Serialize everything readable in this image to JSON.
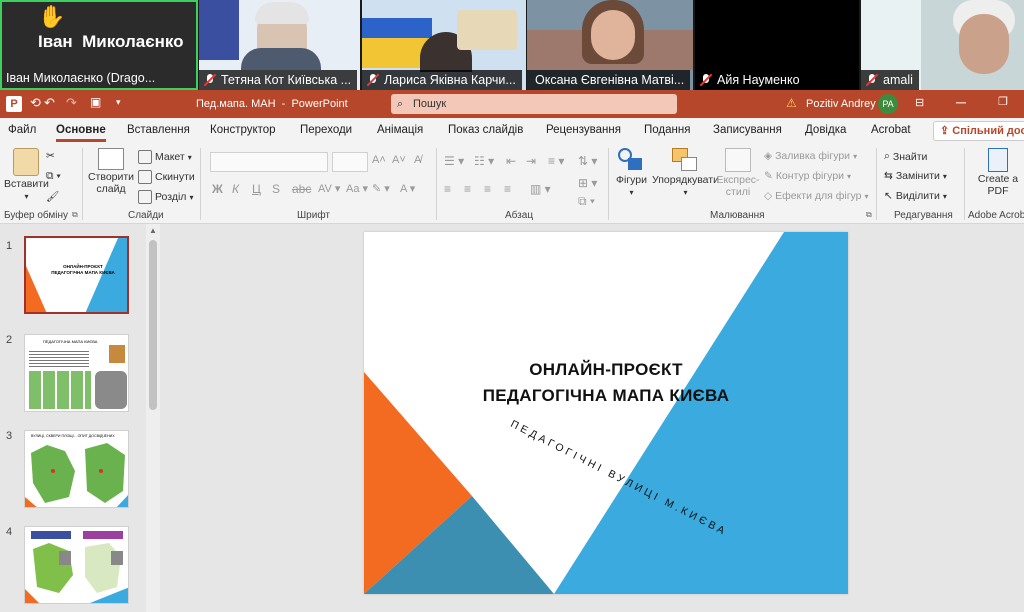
{
  "video": {
    "tiles": [
      {
        "name": "Іван Миколаєнко (Drago..."
      },
      {
        "name": "Тетяна Кот Київська ..."
      },
      {
        "name": "Лариса Яківна Карчи..."
      },
      {
        "name": "Оксана Євгенівна Матві..."
      },
      {
        "name": "Айя Науменко"
      },
      {
        "name": "amali"
      }
    ],
    "big_name": "Іван  Миколаєнко",
    "hand_icon": "raised-hand-icon"
  },
  "titlebar": {
    "file_title": "Пед.мапа. МАН  -  PowerPoint",
    "search_placeholder": "Пошук",
    "user_name": "Pozitiv Andrey",
    "user_initials": "PA"
  },
  "tabs": [
    "Файл",
    "Основне",
    "Вставлення",
    "Конструктор",
    "Переходи",
    "Анімація",
    "Показ слайдів",
    "Рецензування",
    "Подання",
    "Записування",
    "Довідка",
    "Acrobat"
  ],
  "share_label": "Спільний дос",
  "ribbon": {
    "paste": "Вставити",
    "clipboard_group": "Буфер обміну",
    "new_slide": "Створити слайд",
    "layout": "Макет",
    "reset": "Скинути",
    "section": "Розділ",
    "slides_group": "Слайди",
    "font_group": "Шрифт",
    "paragraph_group": "Абзац",
    "shapes": "Фігури",
    "arrange": "Упорядкувати",
    "quick_styles": "Експрес-стилі",
    "shape_fill": "Заливка фігури",
    "shape_outline": "Контур фігури",
    "shape_effects": "Ефекти для фігур",
    "drawing_group": "Малювання",
    "find": "Знайти",
    "replace": "Замінити",
    "select": "Виділити",
    "editing_group": "Редагування",
    "create_pdf": "Create a PDF",
    "acrobat_group": "Adobe Acrobat"
  },
  "slides": {
    "numbers": [
      "1",
      "2",
      "3",
      "4"
    ],
    "thumb1_title": "ОНЛАЙН-ПРОЄКТ ПЕДАГОГІЧНА МАПА КИЄВА",
    "thumb2_title": "ПЕДАГОГІЧНА МАПА КИЄВА",
    "thumb3_title": "ВУЛИЦІ, СКВЕРИ ПЛОЩІ... ОПИТ ДОСВІДЧЕНИХ"
  },
  "main_slide": {
    "title_line1": "ОНЛАЙН-ПРОЄКТ",
    "title_line2": "ПЕДАГОГІЧНА МАПА КИЄВА",
    "subtitle": "ПЕДАГОГІЧНІ ВУЛИЦІ М.КИЄВА"
  },
  "colors": {
    "accent": "#b7472a",
    "blue": "#3aaadf",
    "orange": "#f26b21",
    "teal": "#3c8fb0"
  }
}
